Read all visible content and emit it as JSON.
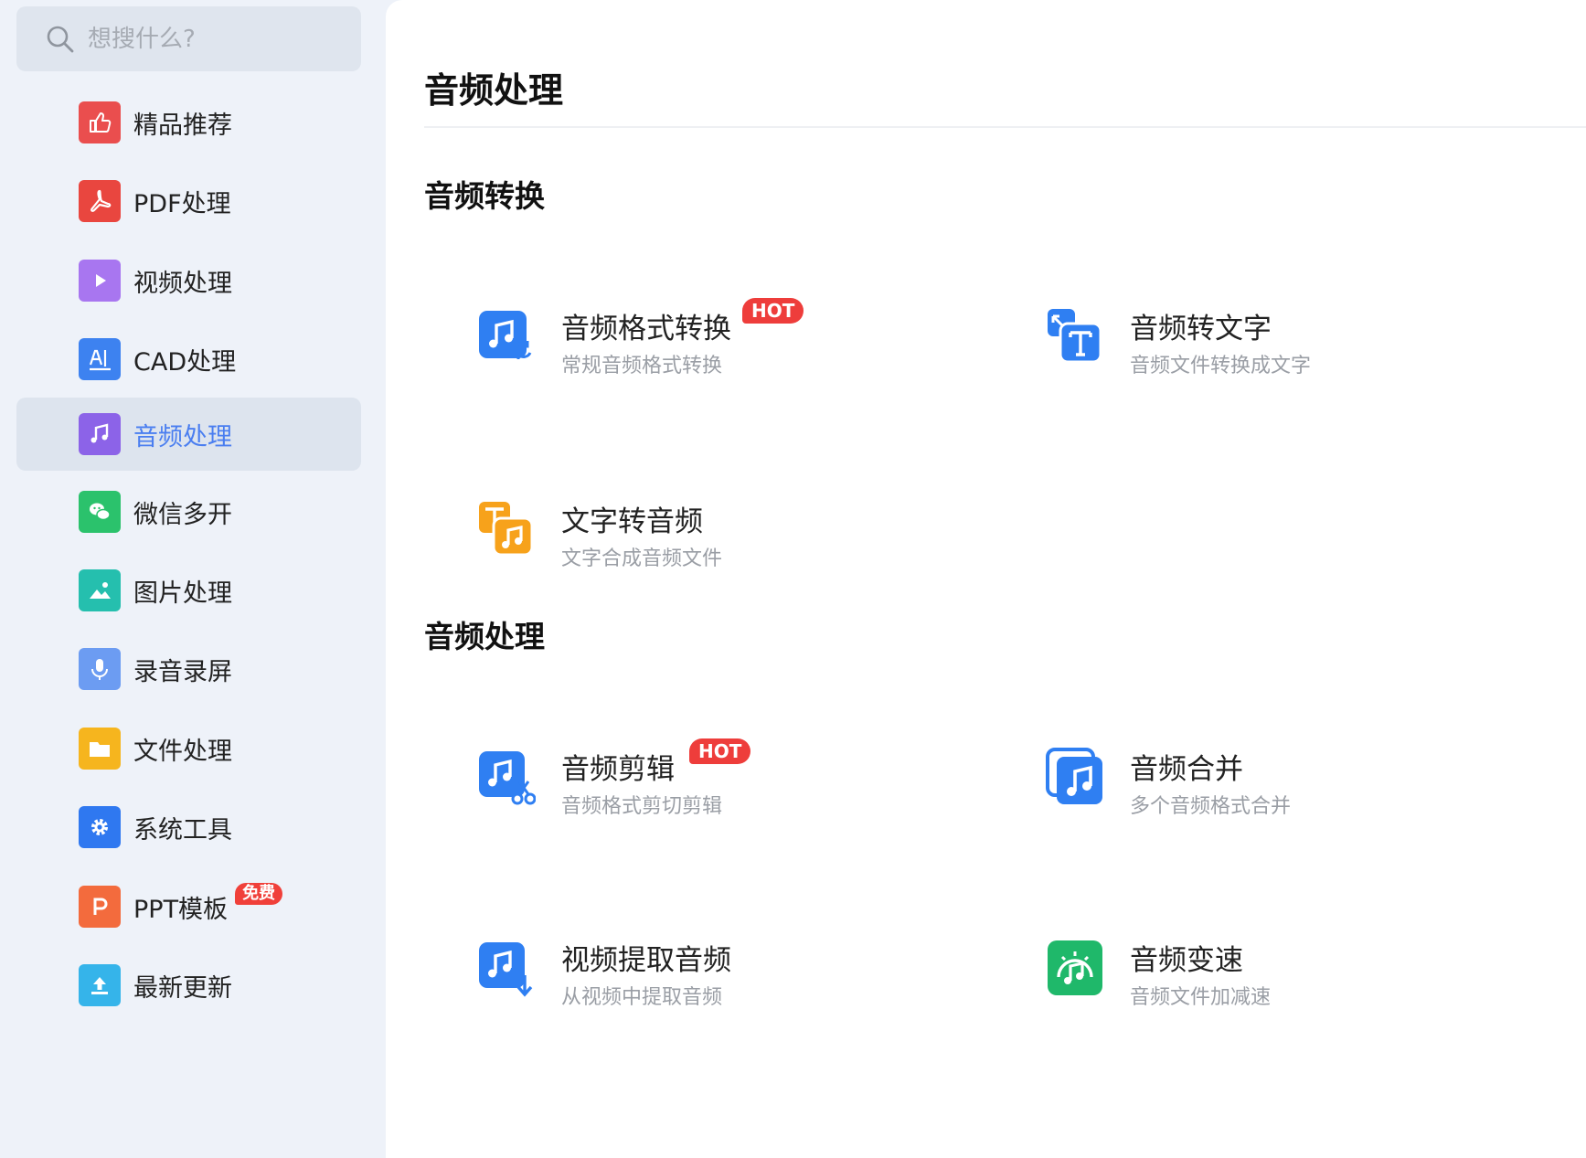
{
  "search": {
    "placeholder": "想搜什么?"
  },
  "sidebar": {
    "items": [
      {
        "label": "精品推荐",
        "icon": "thumbs-up-icon",
        "color": "#ea4e4e"
      },
      {
        "label": "PDF处理",
        "icon": "pdf-icon",
        "color": "#e9463f"
      },
      {
        "label": "视频处理",
        "icon": "play-icon",
        "color": "#a876f0"
      },
      {
        "label": "CAD处理",
        "icon": "cad-icon",
        "color": "#3d82f0"
      },
      {
        "label": "音频处理",
        "icon": "music-note-icon",
        "color": "#8c63e8",
        "active": true
      },
      {
        "label": "微信多开",
        "icon": "wechat-icon",
        "color": "#2bc26c"
      },
      {
        "label": "图片处理",
        "icon": "image-icon",
        "color": "#25bfae"
      },
      {
        "label": "录音录屏",
        "icon": "microphone-icon",
        "color": "#6c9cf2"
      },
      {
        "label": "文件处理",
        "icon": "folder-icon",
        "color": "#f6b51e"
      },
      {
        "label": "系统工具",
        "icon": "gear-icon",
        "color": "#2f78f0"
      },
      {
        "label": "PPT模板",
        "icon": "ppt-icon",
        "color": "#f36b3d",
        "badge": "免费"
      },
      {
        "label": "最新更新",
        "icon": "upload-icon",
        "color": "#35b4ea"
      }
    ]
  },
  "main": {
    "title": "音频处理",
    "sections": [
      {
        "title": "音频转换",
        "tools": [
          {
            "title": "音频格式转换",
            "subtitle": "常规音频格式转换",
            "badge": "HOT",
            "icon": "audio-convert-icon"
          },
          {
            "title": "音频转文字",
            "subtitle": "音频文件转换成文字",
            "icon": "audio-to-text-icon"
          },
          {
            "title": "文字转音频",
            "subtitle": "文字合成音频文件",
            "icon": "text-to-audio-icon"
          }
        ]
      },
      {
        "title": "音频处理",
        "tools": [
          {
            "title": "音频剪辑",
            "subtitle": "音频格式剪切剪辑",
            "badge": "HOT",
            "icon": "audio-cut-icon"
          },
          {
            "title": "音频合并",
            "subtitle": "多个音频格式合并",
            "icon": "audio-merge-icon"
          },
          {
            "title": "视频提取音频",
            "subtitle": "从视频中提取音频",
            "icon": "video-extract-audio-icon"
          },
          {
            "title": "音频变速",
            "subtitle": "音频文件加减速",
            "icon": "audio-speed-icon"
          }
        ]
      }
    ]
  },
  "colors": {
    "accent": "#4a7ef0",
    "hot": "#ee3d3b",
    "icon_blue": "#2f7ff2",
    "icon_orange": "#f7a21b",
    "icon_green": "#1fb86a"
  }
}
